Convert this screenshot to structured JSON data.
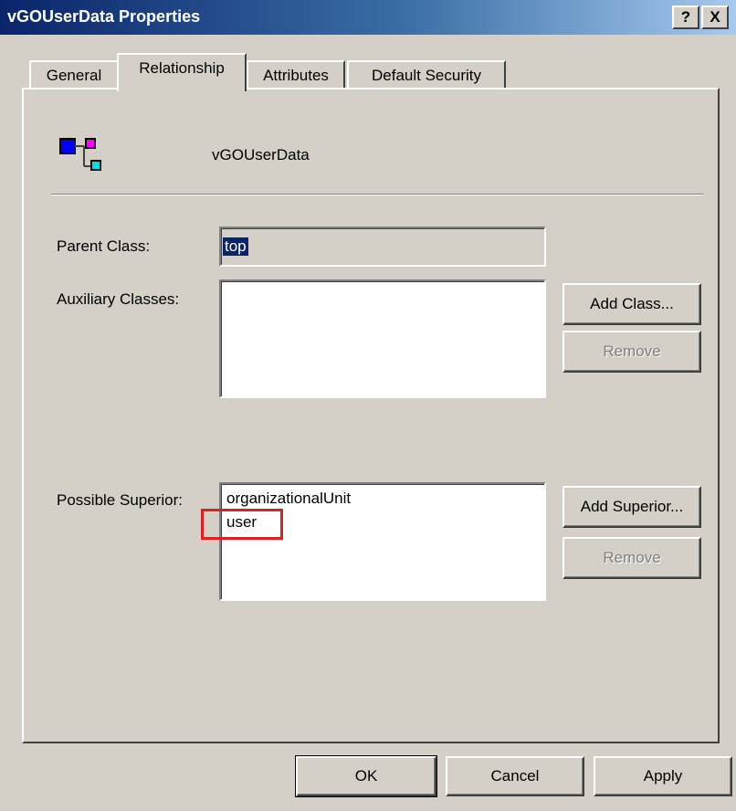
{
  "window": {
    "title": "vGOUserData Properties",
    "help_button": "?",
    "close_button": "X"
  },
  "tabs": [
    {
      "label": "General"
    },
    {
      "label": "Relationship"
    },
    {
      "label": "Attributes"
    },
    {
      "label": "Default Security"
    }
  ],
  "header": {
    "class_name": "vGOUserData",
    "icon": "class-hierarchy-icon"
  },
  "parent_class": {
    "label": "Parent Class:",
    "value": "top"
  },
  "auxiliary_classes": {
    "label": "Auxiliary Classes:",
    "items": [],
    "add_button": "Add Class...",
    "remove_button": "Remove"
  },
  "possible_superior": {
    "label": "Possible Superior:",
    "items": [
      "organizationalUnit",
      "user"
    ],
    "add_button": "Add Superior...",
    "remove_button": "Remove"
  },
  "footer": {
    "ok": "OK",
    "cancel": "Cancel",
    "apply": "Apply"
  },
  "colors": {
    "highlight_box": "#e02020",
    "selection": "#0a246a"
  }
}
